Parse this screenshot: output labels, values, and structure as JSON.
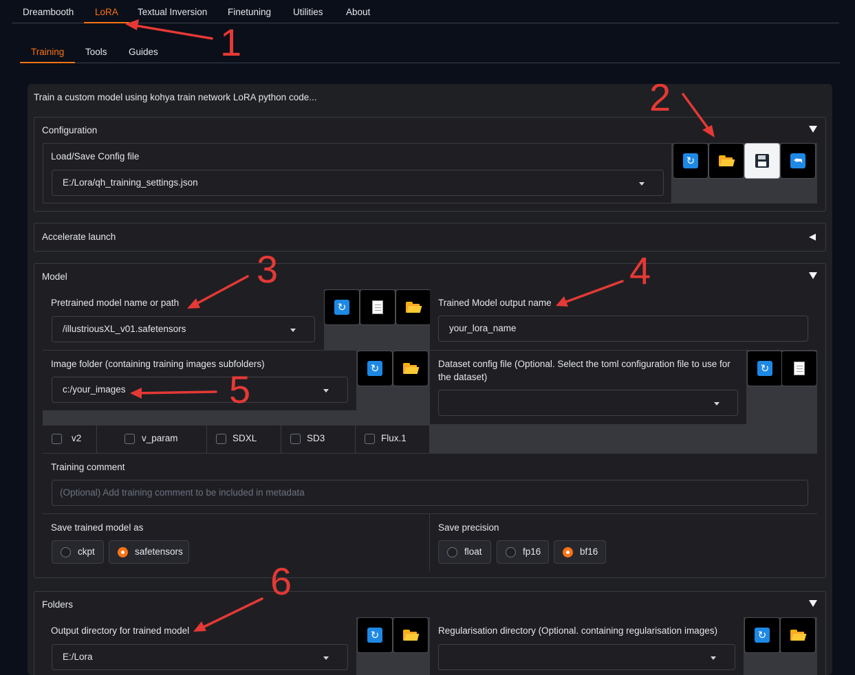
{
  "top_tabs": [
    "Dreambooth",
    "LoRA",
    "Textual Inversion",
    "Finetuning",
    "Utilities",
    "About"
  ],
  "sub_tabs": [
    "Training",
    "Tools",
    "Guides"
  ],
  "description": "Train a custom model using kohya train network LoRA python code...",
  "configuration": {
    "title": "Configuration",
    "label": "Load/Save Config file",
    "value": "E:/Lora/qh_training_settings.json",
    "buttons": [
      "refresh-icon",
      "folder-icon",
      "save-icon",
      "return-icon"
    ]
  },
  "accelerate": {
    "title": "Accelerate launch"
  },
  "model": {
    "title": "Model",
    "pretrained_label": "Pretrained model name or path",
    "pretrained_value": "/illustriousXL_v01.safetensors",
    "output_name_label": "Trained Model output name",
    "output_name_value": "your_lora_name",
    "image_folder_label": "Image folder (containing training images subfolders)",
    "image_folder_value": "c:/your_images",
    "dataset_label_1": "Dataset config file (Optional. Select the toml configuration file to use for",
    "dataset_label_2": "the dataset)",
    "dataset_value": "",
    "checkboxes": [
      "v2",
      "v_param",
      "SDXL",
      "SD3",
      "Flux.1"
    ],
    "comment_label": "Training comment",
    "comment_placeholder": "(Optional) Add training comment to be included in metadata",
    "save_as_label": "Save trained model as",
    "save_as_options": [
      "ckpt",
      "safetensors"
    ],
    "save_as_selected": "safetensors",
    "precision_label": "Save precision",
    "precision_options": [
      "float",
      "fp16",
      "bf16"
    ],
    "precision_selected": "bf16"
  },
  "folders": {
    "title": "Folders",
    "output_dir_label": "Output directory for trained model",
    "output_dir_value": "E:/Lora",
    "reg_dir_label": "Regularisation directory (Optional. containing regularisation images)",
    "reg_dir_value": ""
  },
  "annotations": [
    "1",
    "2",
    "3",
    "4",
    "5",
    "6"
  ],
  "colors": {
    "accent": "#f97316",
    "annotation": "#e53935",
    "icon_blue": "#1e88e5",
    "folder_yellow": "#f9a825"
  }
}
